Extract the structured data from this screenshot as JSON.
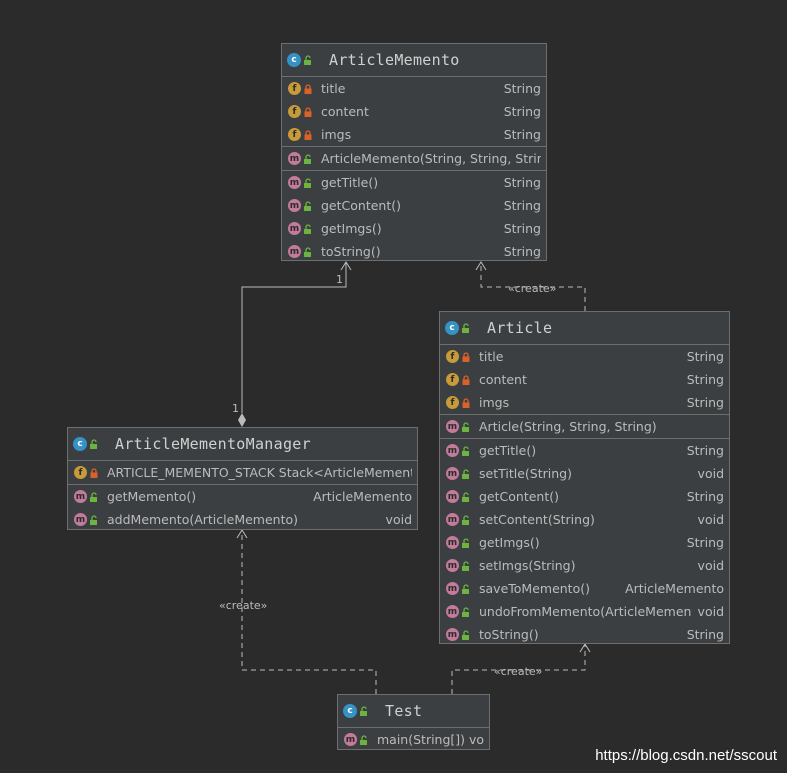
{
  "colors": {
    "background": "#2b2b2b",
    "box": "#3c3f41",
    "class_icon": "#3592c4",
    "field_icon": "#c79a3a",
    "method_icon": "#c27b9a",
    "private_lock": "#d9622b",
    "public_unlock": "#6db33f"
  },
  "classes": {
    "article_memento": {
      "name": "ArticleMemento",
      "fields": [
        {
          "name": "title",
          "type": "String"
        },
        {
          "name": "content",
          "type": "String"
        },
        {
          "name": "imgs",
          "type": "String"
        }
      ],
      "constructor": {
        "name": "ArticleMemento(String, String, String)",
        "type": ""
      },
      "methods": [
        {
          "name": "getTitle()",
          "type": "String"
        },
        {
          "name": "getContent()",
          "type": "String"
        },
        {
          "name": "getImgs()",
          "type": "String"
        },
        {
          "name": "toString()",
          "type": "String"
        }
      ]
    },
    "article": {
      "name": "Article",
      "fields": [
        {
          "name": "title",
          "type": "String"
        },
        {
          "name": "content",
          "type": "String"
        },
        {
          "name": "imgs",
          "type": "String"
        }
      ],
      "constructor": {
        "name": "Article(String, String, String)",
        "type": ""
      },
      "methods": [
        {
          "name": "getTitle()",
          "type": "String"
        },
        {
          "name": "setTitle(String)",
          "type": "void"
        },
        {
          "name": "getContent()",
          "type": "String"
        },
        {
          "name": "setContent(String)",
          "type": "void"
        },
        {
          "name": "getImgs()",
          "type": "String"
        },
        {
          "name": "setImgs(String)",
          "type": "void"
        },
        {
          "name": "saveToMemento()",
          "type": "ArticleMemento"
        },
        {
          "name": "undoFromMemento(ArticleMemento)",
          "type": "void"
        },
        {
          "name": "toString()",
          "type": "String"
        }
      ]
    },
    "article_memento_manager": {
      "name": "ArticleMementoManager",
      "fields": [
        {
          "name": "ARTICLE_MEMENTO_STACK Stack<ArticleMemento>",
          "type": ""
        }
      ],
      "methods": [
        {
          "name": "getMemento()",
          "type": "ArticleMemento"
        },
        {
          "name": "addMemento(ArticleMemento)",
          "type": "void"
        }
      ]
    },
    "test": {
      "name": "Test",
      "methods": [
        {
          "name": "main(String[]) void",
          "type": ""
        }
      ]
    }
  },
  "relations": {
    "create_label": "«create»",
    "multiplicity_top": "1",
    "multiplicity_bottom": "1"
  },
  "watermark": "https://blog.csdn.net/sscout"
}
